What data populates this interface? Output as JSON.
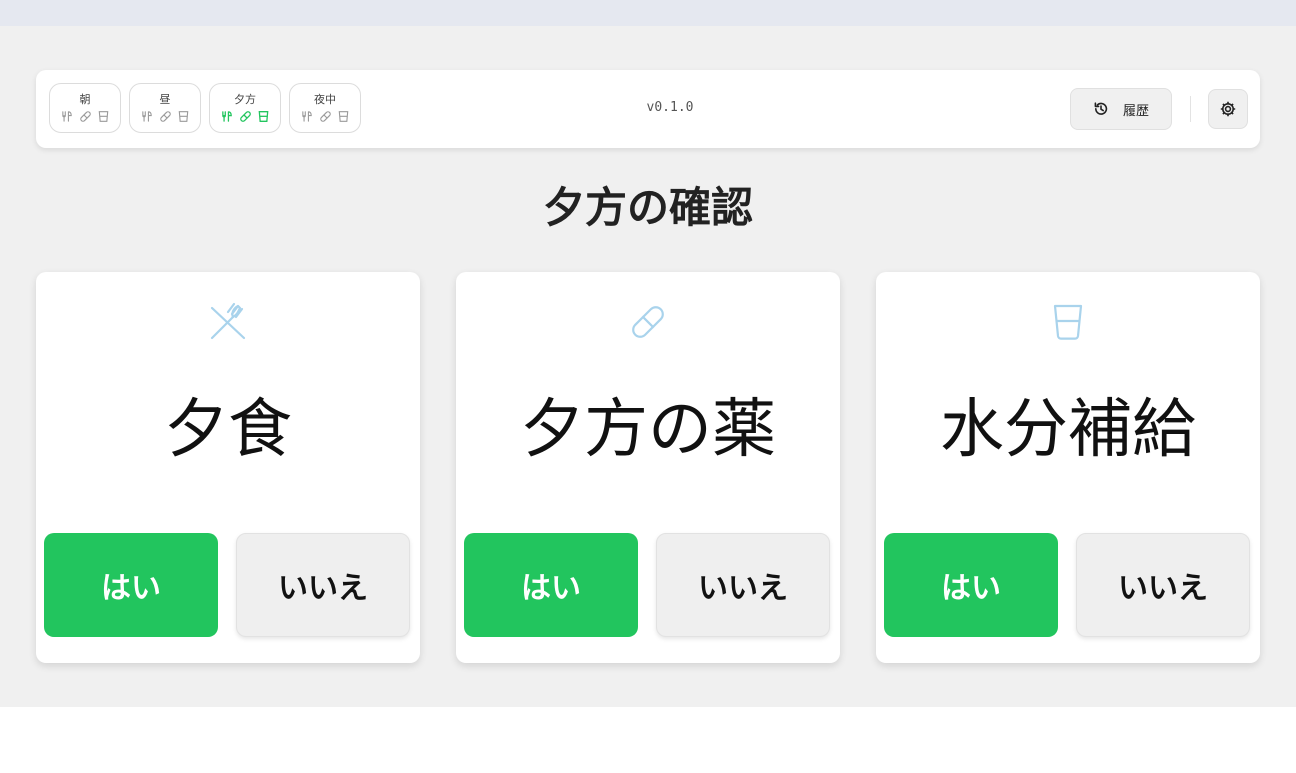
{
  "header": {
    "periods": [
      {
        "label": "朝",
        "active": false,
        "icons": [
          "meal-icon",
          "pill-icon",
          "cup-icon"
        ]
      },
      {
        "label": "昼",
        "active": false,
        "icons": [
          "meal-icon",
          "pill-icon",
          "cup-icon"
        ]
      },
      {
        "label": "夕方",
        "active": true,
        "icons": [
          "meal-icon",
          "pill-icon",
          "cup-icon"
        ]
      },
      {
        "label": "夜中",
        "active": false,
        "icons": [
          "meal-icon",
          "pill-icon",
          "cup-icon"
        ]
      }
    ],
    "version": "v0.1.0",
    "history_label": "履歴",
    "history_icon": "history-icon",
    "settings_icon": "gear-icon"
  },
  "page_title": "夕方の確認",
  "cards": [
    {
      "title": "夕食",
      "icon": "fork-knife-icon",
      "yes_label": "はい",
      "no_label": "いいえ"
    },
    {
      "title": "夕方の薬",
      "icon": "pill-icon",
      "yes_label": "はい",
      "no_label": "いいえ"
    },
    {
      "title": "水分補給",
      "icon": "cup-icon",
      "yes_label": "はい",
      "no_label": "いいえ"
    }
  ],
  "colors": {
    "accent": "#22c55e",
    "icon_light": "#a9d3ec",
    "background": "#f0f0f0"
  }
}
